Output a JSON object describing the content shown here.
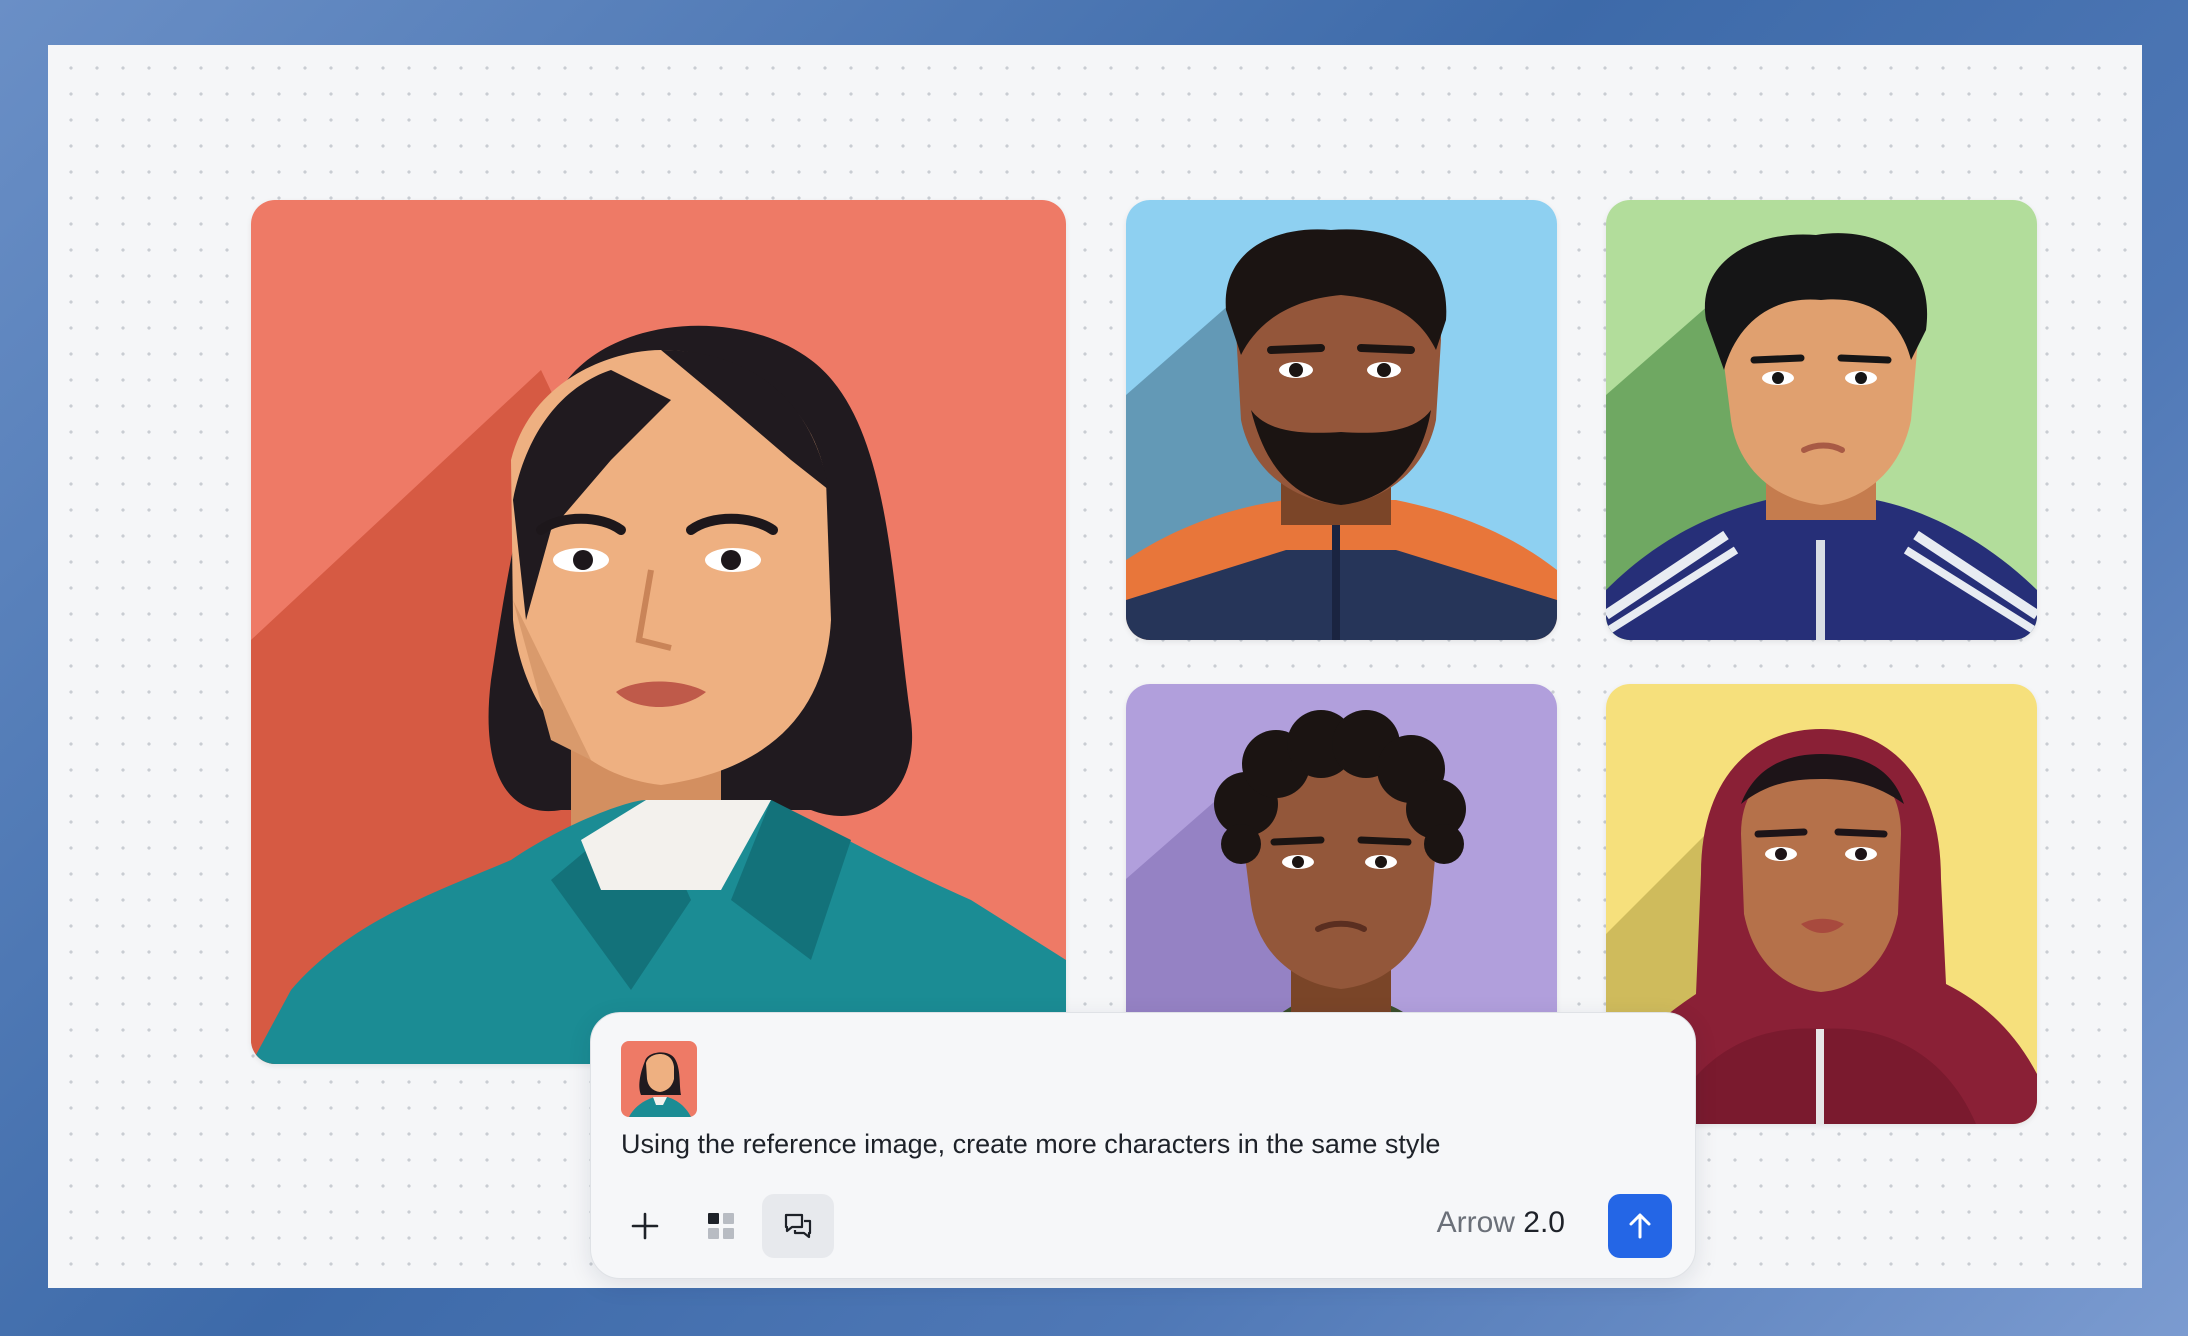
{
  "gallery": {
    "images": [
      {
        "name": "woman-teal-jacket",
        "background": "#ef7a66"
      },
      {
        "name": "bearded-man-orange-jacket",
        "background": "#8ed0f1"
      },
      {
        "name": "man-navy-track-jacket",
        "background": "#b2dd9b"
      },
      {
        "name": "curly-hair-man",
        "background": "#b19fdc"
      },
      {
        "name": "woman-maroon-hijab",
        "background": "#f6e07c"
      }
    ]
  },
  "composer": {
    "prompt": "Using the reference image, create more characters in the same style",
    "attachment": "reference-thumbnail",
    "tools": [
      "add-icon",
      "grid-icon",
      "chat-icon"
    ],
    "model_name": "Arrow",
    "model_version": "2.0",
    "send_icon": "arrow-up-icon",
    "accent": "#2466e6"
  }
}
